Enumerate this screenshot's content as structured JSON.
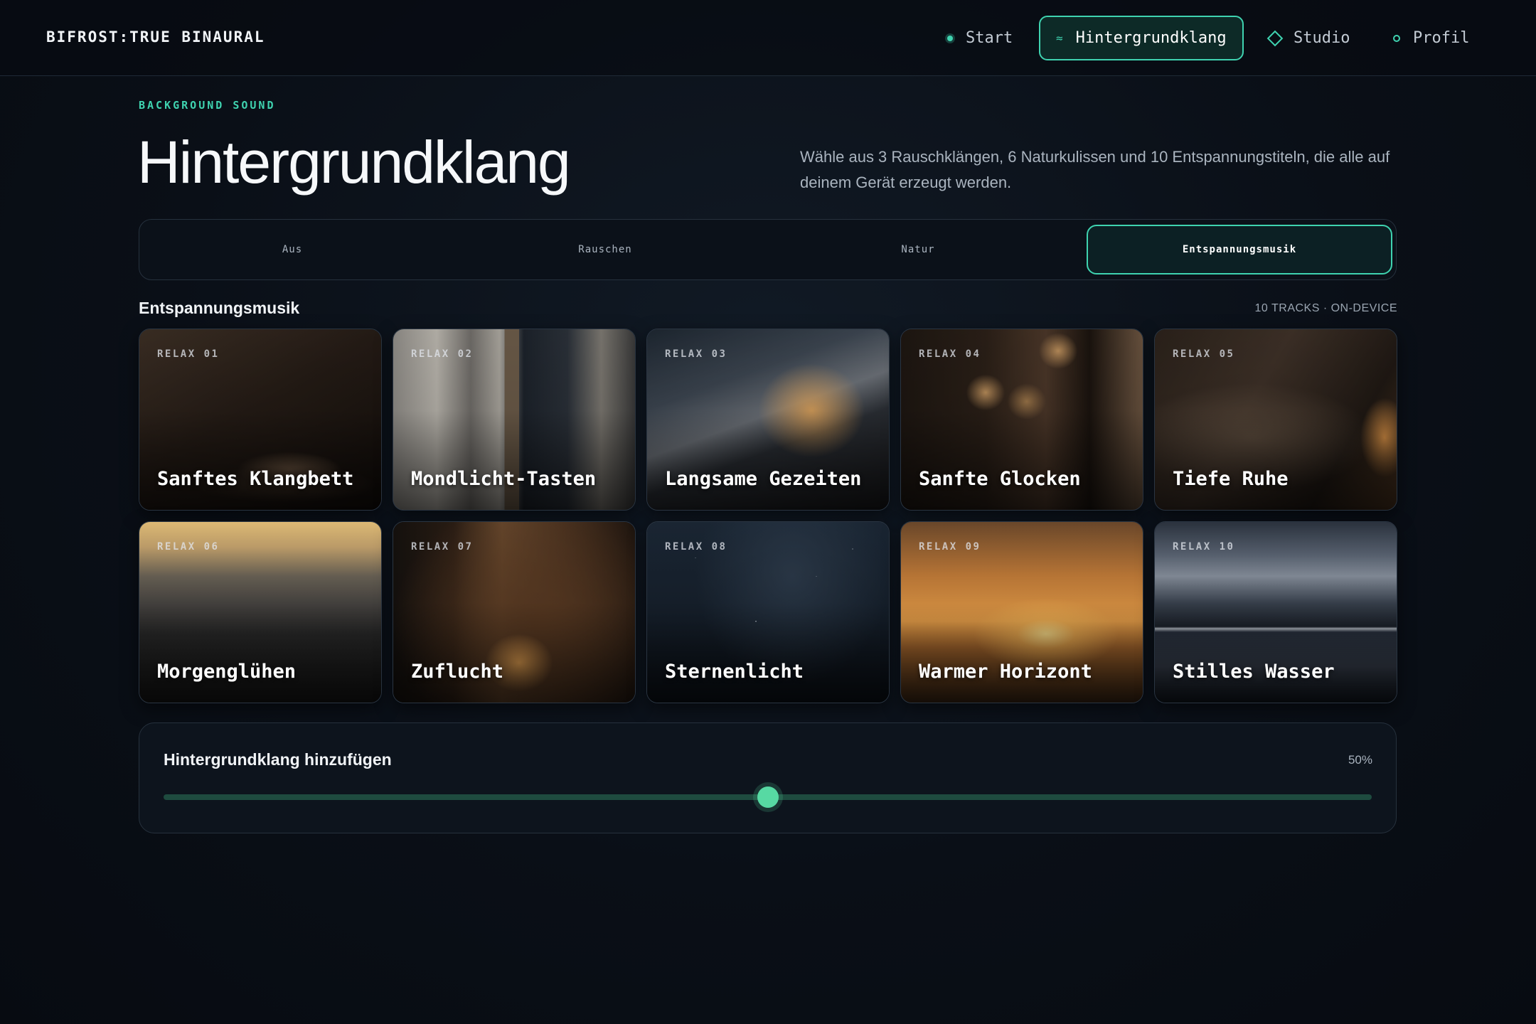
{
  "app": {
    "brand": "BIFROST:TRUE BINAURAL"
  },
  "nav": {
    "items": [
      {
        "label": "Start",
        "icon": "dot-icon",
        "active": false
      },
      {
        "label": "Hintergrundklang",
        "icon": "wave-icon",
        "glyph": "≈",
        "active": true
      },
      {
        "label": "Studio",
        "icon": "diamond-icon",
        "active": false
      },
      {
        "label": "Profil",
        "icon": "ring-icon",
        "active": false
      }
    ]
  },
  "hero": {
    "eyebrow": "BACKGROUND SOUND",
    "title": "Hintergrundklang",
    "description": "Wähle aus 3 Rauschklängen, 6 Naturkulissen und 10 Entspannungstiteln, die alle auf deinem Gerät erzeugt werden."
  },
  "segments": {
    "selected": "Entspannungsmusik",
    "items": [
      {
        "label": "Aus"
      },
      {
        "label": "Rauschen"
      },
      {
        "label": "Natur"
      },
      {
        "label": "Entspannungsmusik"
      }
    ]
  },
  "section": {
    "title": "Entspannungsmusik",
    "meta": "10 TRACKS · ON-DEVICE"
  },
  "tracks": [
    {
      "tag": "RELAX 01",
      "title": "Sanftes Klangbett"
    },
    {
      "tag": "RELAX 02",
      "title": "Mondlicht-Tasten"
    },
    {
      "tag": "RELAX 03",
      "title": "Langsame Gezeiten"
    },
    {
      "tag": "RELAX 04",
      "title": "Sanfte Glocken"
    },
    {
      "tag": "RELAX 05",
      "title": "Tiefe Ruhe"
    },
    {
      "tag": "RELAX 06",
      "title": "Morgenglühen"
    },
    {
      "tag": "RELAX 07",
      "title": "Zuflucht"
    },
    {
      "tag": "RELAX 08",
      "title": "Sternenlicht"
    },
    {
      "tag": "RELAX 09",
      "title": "Warmer Horizont"
    },
    {
      "tag": "RELAX 10",
      "title": "Stilles Wasser"
    }
  ],
  "mix": {
    "label": "Hintergrundklang hinzufügen",
    "value_text": "50%",
    "value": 0.5
  },
  "colors": {
    "accent": "#3fd3b0",
    "slider_thumb": "#57d9a3",
    "background": "#0a0f17"
  }
}
